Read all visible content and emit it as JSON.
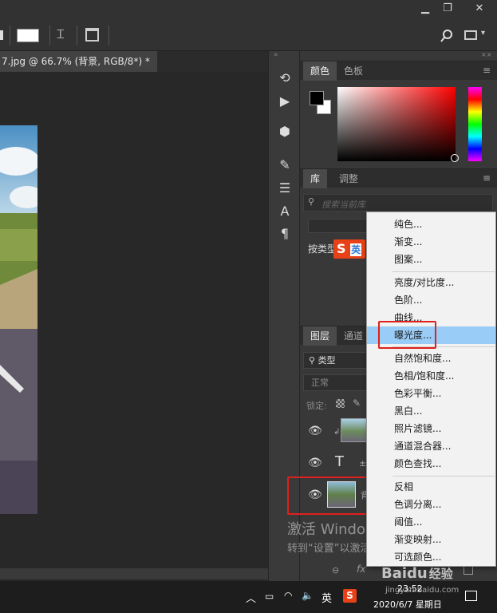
{
  "titlebar": {
    "minimize": "▁",
    "restore": "❐",
    "close": "✕"
  },
  "document": {
    "tab_label": "7.jpg @ 66.7% (背景, RGB/8*) *",
    "tab_close": "×"
  },
  "color_panel": {
    "tabs": [
      "颜色",
      "色板"
    ],
    "fg": "#000000",
    "bg": "#ffffff"
  },
  "library_panel": {
    "tabs": [
      "库",
      "调整"
    ],
    "search_placeholder": "搜索当前库",
    "filter_label": "按类型"
  },
  "layers_panel": {
    "tabs": [
      "图层",
      "通道"
    ],
    "kind": "类型",
    "blend": "正常",
    "lock_label": "锁定:"
  },
  "adjust_menu": {
    "items": [
      "纯色...",
      "渐变...",
      "图案...",
      "亮度/对比度...",
      "色阶...",
      "曲线...",
      "曝光度...",
      "自然饱和度...",
      "色相/饱和度...",
      "色彩平衡...",
      "黑白...",
      "照片滤镜...",
      "通道混合器...",
      "颜色查找...",
      "反相",
      "色调分离...",
      "阈值...",
      "渐变映射...",
      "可选颜色..."
    ],
    "highlighted_index": 6
  },
  "watermark": {
    "line1": "激活 Windows",
    "line2": "转到“设置”以激活 Windows。"
  },
  "taskbar": {
    "ime": "英",
    "time": "23:52",
    "date": "2020/6/7 星期日"
  },
  "baidu": {
    "brand": "Baidu",
    "jingyan": "经验",
    "url": "jingyan.baidu.com"
  }
}
